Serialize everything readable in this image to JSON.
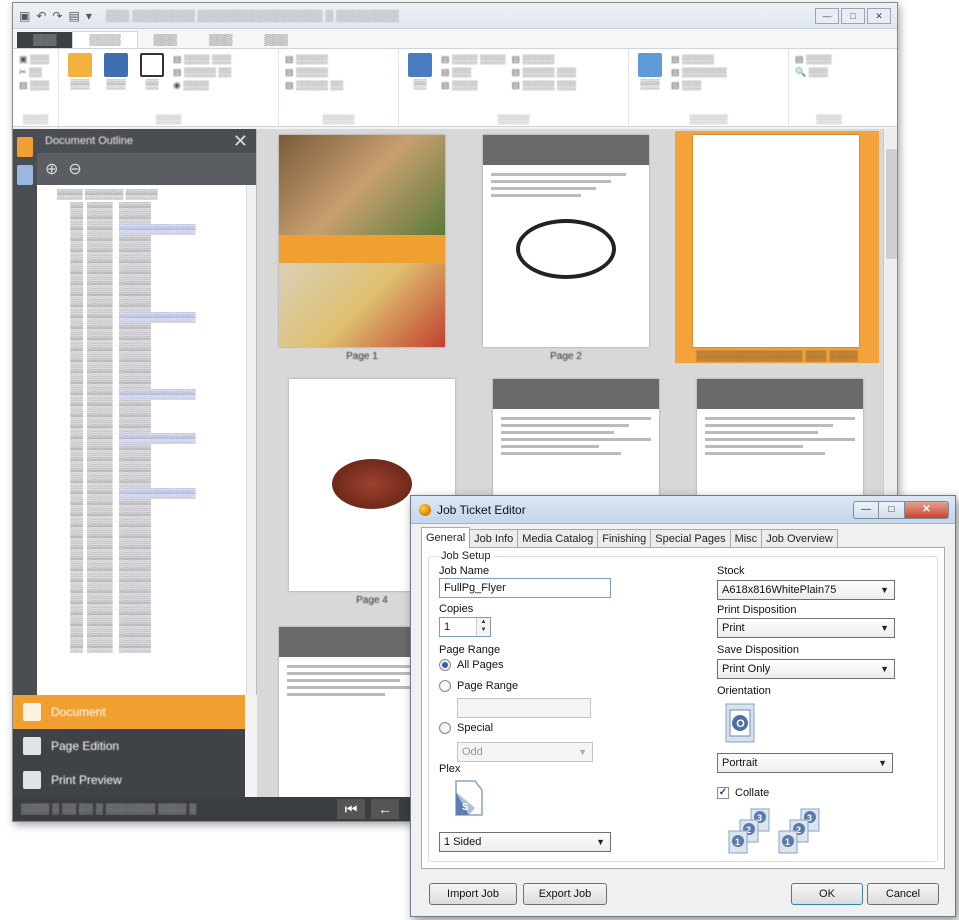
{
  "dialog": {
    "title": "Job Ticket Editor",
    "window_buttons": {
      "minimize": "—",
      "maximize": "□",
      "close": "✕"
    },
    "tabs": [
      {
        "label": "General",
        "active": true
      },
      {
        "label": "Job Info"
      },
      {
        "label": "Media Catalog"
      },
      {
        "label": "Finishing"
      },
      {
        "label": "Special Pages"
      },
      {
        "label": "Misc"
      },
      {
        "label": "Job Overview"
      }
    ],
    "job_setup": {
      "legend": "Job Setup",
      "job_name_label": "Job Name",
      "job_name_value": "FullPg_Flyer",
      "copies_label": "Copies",
      "copies_value": "1",
      "page_range_label": "Page Range",
      "radio_all_pages": "All Pages",
      "radio_page_range": "Page Range",
      "radio_special": "Special",
      "special_value": "Odd",
      "plex_label": "Plex",
      "plex_value": "1 Sided",
      "stock_label": "Stock",
      "stock_value": "A618x816WhitePlain75",
      "print_disposition_label": "Print Disposition",
      "print_disposition_value": "Print",
      "save_disposition_label": "Save Disposition",
      "save_disposition_value": "Print Only",
      "orientation_label": "Orientation",
      "orientation_value": "Portrait",
      "collate_label": "Collate",
      "collate_checked": true
    },
    "buttons": {
      "import_job": "Import Job",
      "export_job": "Export Job",
      "ok": "OK",
      "cancel": "Cancel"
    }
  },
  "background_app": {
    "nav": {
      "document": "Document",
      "page_edition": "Page Edition",
      "print_preview": "Print Preview"
    },
    "panel_title": "Document Outline",
    "page_labels": [
      "Page 1",
      "Page 2",
      "Page 4"
    ]
  },
  "colors": {
    "accent_orange": "#f0a030",
    "dark_panel": "#3f4246",
    "dialog_title_gradient": "#c4d6ea"
  }
}
